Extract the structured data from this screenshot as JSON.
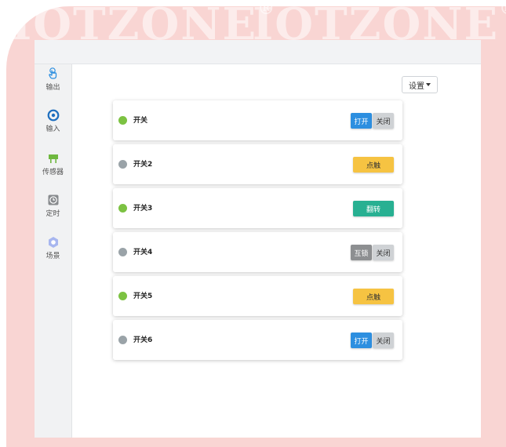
{
  "watermark": {
    "brand": "IOTZONE",
    "mark": "®"
  },
  "nav": {
    "items": [
      {
        "label": "输出"
      },
      {
        "label": "输入"
      },
      {
        "label": "传感器"
      },
      {
        "label": "定时"
      },
      {
        "label": "场景"
      }
    ]
  },
  "toolbar": {
    "settings_label": "设置"
  },
  "switches": [
    {
      "name": "开关",
      "status": "on",
      "buttons": [
        "打开",
        "关闭"
      ]
    },
    {
      "name": "开关2",
      "status": "off",
      "buttons": [
        "点触"
      ]
    },
    {
      "name": "开关3",
      "status": "on",
      "buttons": [
        "翻转"
      ]
    },
    {
      "name": "开关4",
      "status": "off",
      "buttons": [
        "互锁",
        "关闭"
      ]
    },
    {
      "name": "开关5",
      "status": "on",
      "buttons": [
        "点触"
      ]
    },
    {
      "name": "开关6",
      "status": "off",
      "buttons": [
        "打开",
        "关闭"
      ]
    }
  ],
  "colors": {
    "status_on": "#7cc242",
    "status_off": "#9aa3a8",
    "primary": "#2d8fe0",
    "warning": "#f6c342",
    "teal": "#28b092"
  }
}
